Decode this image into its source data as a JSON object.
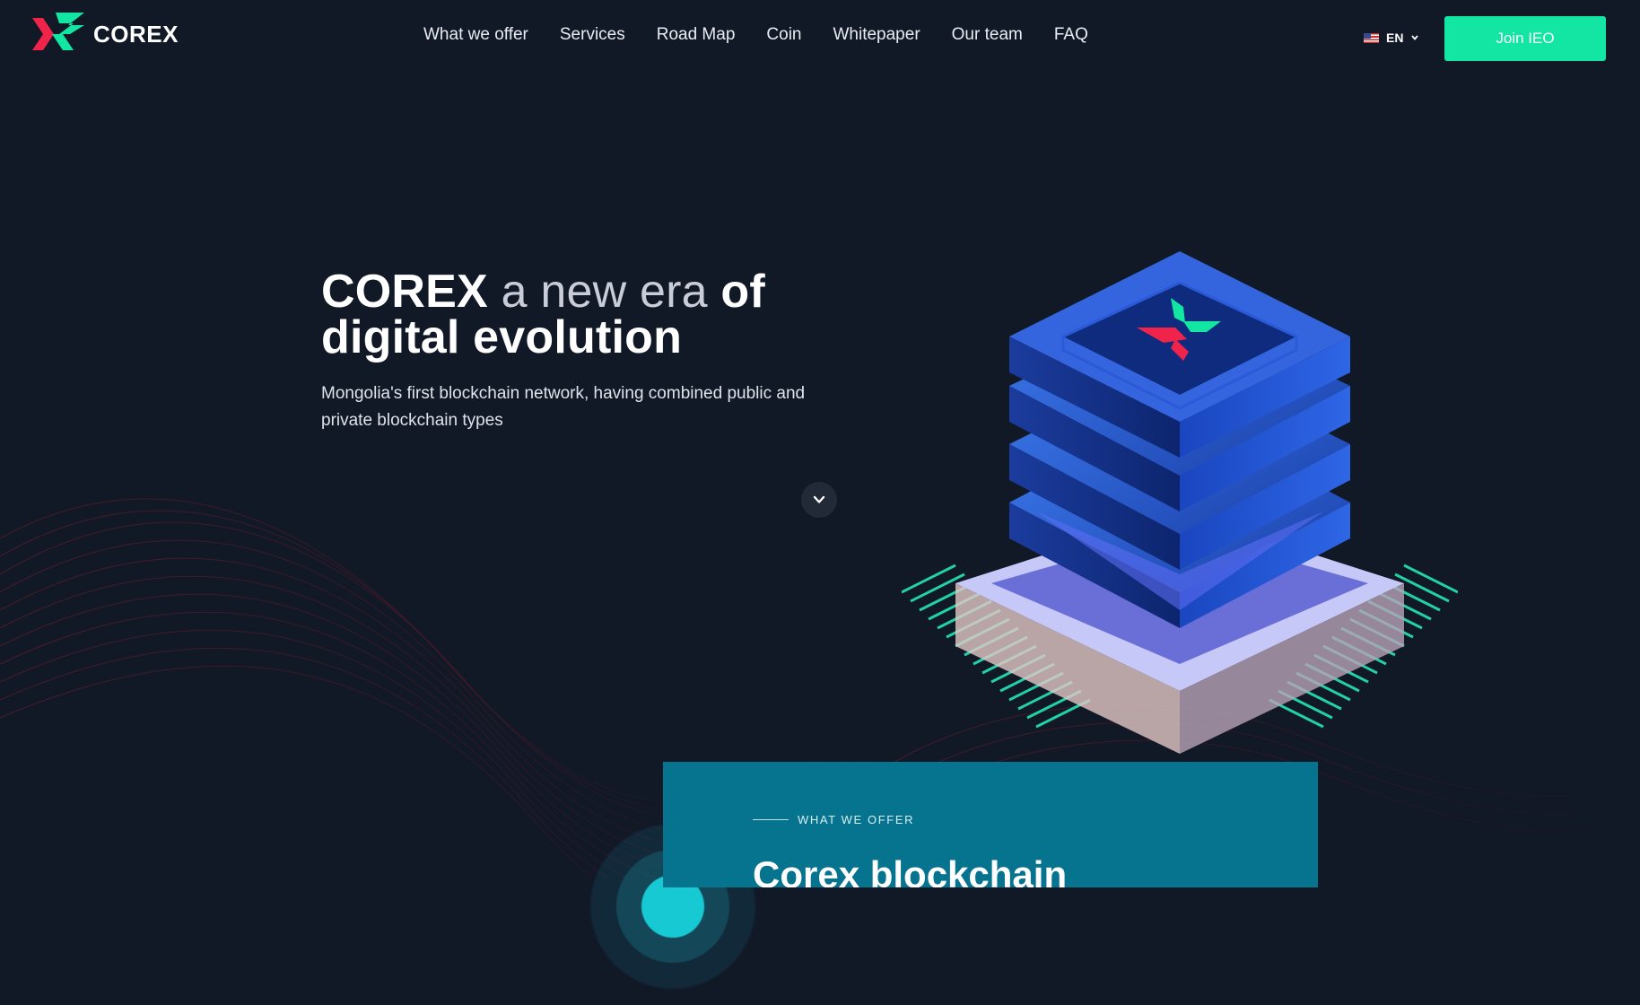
{
  "brand": {
    "name": "COREX",
    "accent": "#12e6a2",
    "red": "#f0234b"
  },
  "nav": {
    "items": [
      {
        "label": "What we offer"
      },
      {
        "label": "Services"
      },
      {
        "label": "Road Map"
      },
      {
        "label": "Coin"
      },
      {
        "label": "Whitepaper"
      },
      {
        "label": "Our team"
      },
      {
        "label": "FAQ"
      }
    ]
  },
  "language": {
    "code": "EN",
    "icon": "us-flag-icon"
  },
  "join_button": {
    "label": "Join IEO"
  },
  "hero": {
    "title_bold_1": "COREX",
    "title_thin": "a new era",
    "title_bold_2": "of",
    "title_line2": "digital evolution",
    "subtitle": "Mongolia's first blockchain network, having combined public and private blockchain types"
  },
  "scroll": {
    "icon": "chevron-down-icon"
  },
  "offer": {
    "eyebrow": "WHAT WE OFFER",
    "title": "Corex blockchain"
  },
  "colors": {
    "background": "#111826",
    "panel": "#06748f",
    "button": "#12e6a2"
  }
}
